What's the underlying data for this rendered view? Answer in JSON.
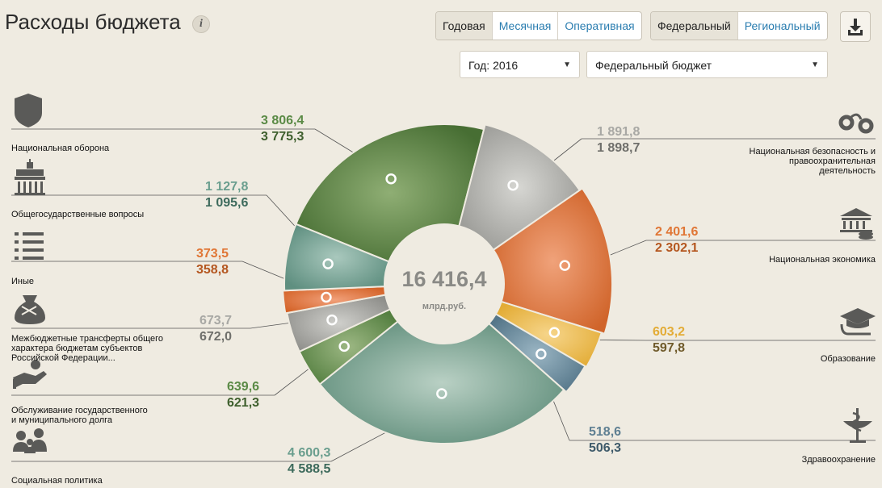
{
  "header": {
    "title": "Расходы бюджета",
    "info_label": "i",
    "period_tabs": [
      "Годовая",
      "Месячная",
      "Оперативная"
    ],
    "level_tabs": [
      "Федеральный",
      "Региональный"
    ],
    "year_select": "Год: 2016",
    "budget_select": "Федеральный бюджет"
  },
  "center": {
    "total": "16 416,4",
    "unit": "млрд.руб."
  },
  "colors": {
    "defense": "#4f7a3a",
    "security": "#a9a9a5",
    "economy": "#d76a2c",
    "education": "#e8b43f",
    "health": "#5e7f92",
    "social": "#6e9a88",
    "debt": "#5e8a4a",
    "transfers": "#9a9a96",
    "other": "#d96b2c",
    "general": "#6d9a8d"
  },
  "chart_data": {
    "type": "pie",
    "title": "Расходы бюджета",
    "total": 16416.4,
    "unit": "млрд.руб.",
    "categories": [
      "Национальная оборона",
      "Национальная безопасность и правоохранительная деятельность",
      "Национальная экономика",
      "Образование",
      "Здравоохранение",
      "Социальная политика",
      "Обслуживание государственного и муниципального долга",
      "Межбюджетные трансферты общего характера бюджетам субъектов Российской Федерации...",
      "Иные",
      "Общегосударственные вопросы"
    ],
    "series": [
      {
        "values": [
          3806.4,
          1891.8,
          2401.6,
          603.2,
          518.6,
          4600.3,
          639.6,
          673.7,
          373.5,
          1127.8
        ]
      },
      {
        "values": [
          3775.3,
          1898.7,
          2302.1,
          597.8,
          506.3,
          4588.5,
          621.3,
          672.0,
          358.8,
          1095.6
        ]
      }
    ]
  },
  "labels": {
    "defense": {
      "name": "Национальная оборона",
      "v1": "3 806,4",
      "v2": "3 775,3"
    },
    "general": {
      "name": "Общегосударственные вопросы",
      "v1": "1 127,8",
      "v2": "1 095,6"
    },
    "other": {
      "name": "Иные",
      "v1": "373,5",
      "v2": "358,8"
    },
    "transfers": {
      "name_1": "Межбюджетные трансферты общего",
      "name_2": "характера бюджетам субъектов",
      "name_3": "Российской Федерации...",
      "v1": "673,7",
      "v2": "672,0"
    },
    "debt": {
      "name_1": "Обслуживание государственного",
      "name_2": "и муниципального долга",
      "v1": "639,6",
      "v2": "621,3"
    },
    "social": {
      "name": "Социальная политика",
      "v1": "4 600,3",
      "v2": "4 588,5"
    },
    "security": {
      "name_1": "Национальная безопасность и",
      "name_2": "правоохранительная",
      "name_3": "деятельность",
      "v1": "1 891,8",
      "v2": "1 898,7"
    },
    "economy": {
      "name": "Национальная экономика",
      "v1": "2 401,6",
      "v2": "2 302,1"
    },
    "education": {
      "name": "Образование",
      "v1": "603,2",
      "v2": "597,8"
    },
    "health": {
      "name": "Здравоохранение",
      "v1": "518,6",
      "v2": "506,3"
    }
  }
}
